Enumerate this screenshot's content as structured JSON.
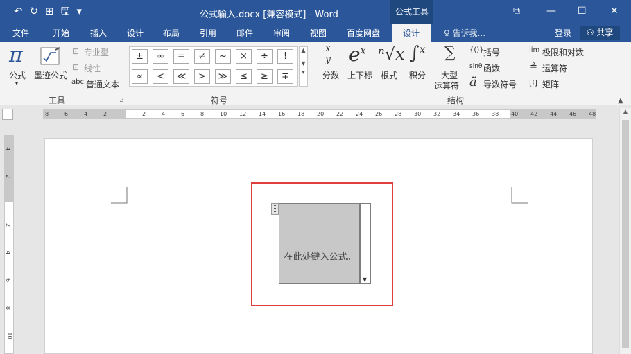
{
  "window": {
    "title": "公式输入.docx [兼容模式] - Word",
    "context_tool": "公式工具",
    "controls": {
      "restore_ribbon": "⧉",
      "minimize": "—",
      "maximize": "☐",
      "close": "✕"
    }
  },
  "qat": {
    "undo": "↶",
    "redo": "↻",
    "touch": "⊞",
    "save": "🖫",
    "customize": "▾"
  },
  "tabs": [
    {
      "label": "文件"
    },
    {
      "label": "开始"
    },
    {
      "label": "插入"
    },
    {
      "label": "设计"
    },
    {
      "label": "布局"
    },
    {
      "label": "引用"
    },
    {
      "label": "邮件"
    },
    {
      "label": "审阅"
    },
    {
      "label": "视图"
    },
    {
      "label": "百度网盘"
    },
    {
      "label": "设计"
    }
  ],
  "tell_me": "告诉我...",
  "sign_in": "登录",
  "share": "共享",
  "ribbon": {
    "tools": {
      "group_label": "工具",
      "equation": "公式",
      "ink_equation": "墨迹公式",
      "professional": "专业型",
      "linear": "线性",
      "normal_text": "普通文本",
      "abc": "abc"
    },
    "symbols": {
      "group_label": "符号",
      "row1": [
        "±",
        "∞",
        "=",
        "≠",
        "~",
        "×",
        "÷",
        "!"
      ],
      "row2": [
        "∝",
        "<",
        "≪",
        ">",
        "≫",
        "≤",
        "≥",
        "∓"
      ]
    },
    "structures": {
      "group_label": "结构",
      "fraction": "分数",
      "script": "上下标",
      "radical": "根式",
      "integral": "积分",
      "large_operator_1": "大型",
      "large_operator_2": "运算符",
      "bracket": "括号",
      "function": "函数",
      "accent": "导数符号",
      "limit_log": "极限和对数",
      "operator": "运算符",
      "matrix": "矩阵"
    }
  },
  "ruler": {
    "h_ticks": [
      "8",
      "6",
      "4",
      "2",
      "2",
      "4",
      "6",
      "8",
      "10",
      "12",
      "14",
      "16",
      "18",
      "20",
      "22",
      "24",
      "26",
      "28",
      "30",
      "32",
      "34",
      "36",
      "38",
      "40",
      "42",
      "44",
      "46",
      "48"
    ],
    "v_ticks": [
      "4",
      "2",
      "2",
      "4",
      "6",
      "8",
      "10"
    ]
  },
  "document": {
    "equation_placeholder": "在此处键入公式。"
  }
}
